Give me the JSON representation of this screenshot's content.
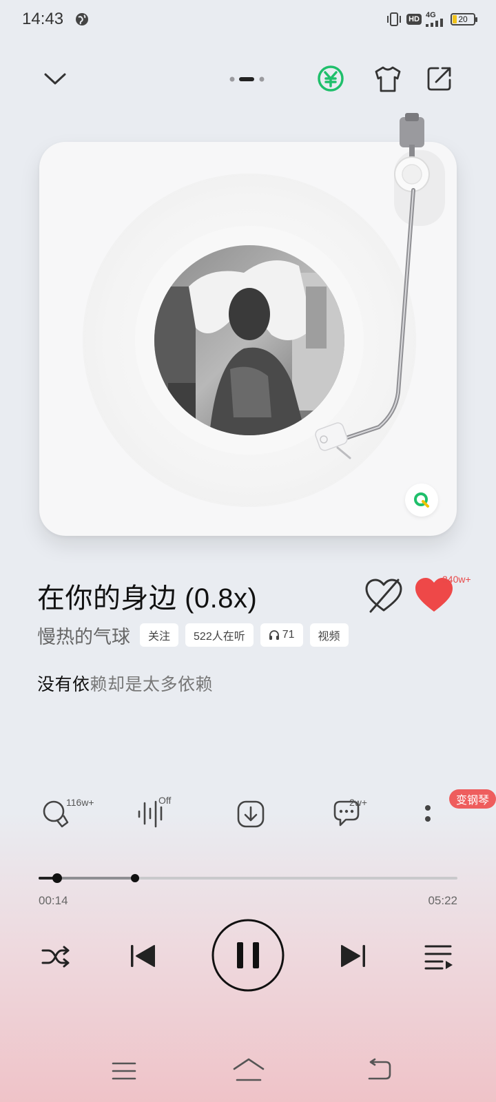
{
  "status_bar": {
    "time": "14:43",
    "network": "4G",
    "hd": "HD",
    "battery": "20",
    "icons": [
      "globe-icon",
      "vibrate-icon",
      "hd-icon",
      "signal-icon",
      "battery-icon"
    ]
  },
  "toolbar": {
    "page_indicator": {
      "count": 3,
      "active": 2
    },
    "icons": [
      "chevron-down-icon",
      "vip-yen-icon",
      "tshirt-icon",
      "share-icon"
    ],
    "accent_color": "#1fbf6b"
  },
  "song": {
    "title": "在你的身边 (0.8x)",
    "artist": "慢热的气球",
    "like_count": "340w+",
    "tags": {
      "follow": "关注",
      "listeners": "522人在听",
      "headphone_count": "71",
      "video": "视频"
    }
  },
  "lyric": {
    "sung": "没有依",
    "rest": "赖却是太多依赖"
  },
  "actions": {
    "search_count": "116w+",
    "effect_state": "Off",
    "comment_count": "2w+",
    "piano_badge": "变钢琴"
  },
  "progress": {
    "current": "00:14",
    "total": "05:22",
    "played_fraction": 0.044,
    "buffered_fraction": 0.23
  },
  "colors": {
    "like": "#ee4848",
    "badge": "#ee5d5d",
    "brand_green": "#1fbf6b"
  }
}
